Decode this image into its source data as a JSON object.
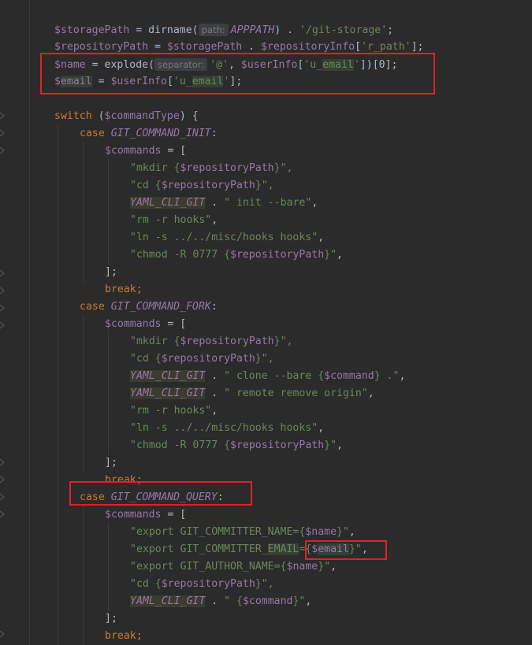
{
  "editor": {
    "lines": [
      {
        "indent": 69,
        "tokens": [
          {
            "t": "$storagePath",
            "c": "var"
          },
          {
            "t": " = ",
            "c": "plain"
          },
          {
            "t": "dirname(",
            "c": "plain"
          },
          {
            "t": "path:",
            "c": "hint"
          },
          {
            "t": "APPPATH",
            "c": "const"
          },
          {
            "t": ") . ",
            "c": "plain"
          },
          {
            "t": "'/git-storage'",
            "c": "str"
          },
          {
            "t": ";",
            "c": "plain"
          }
        ]
      },
      {
        "indent": 69,
        "tokens": [
          {
            "t": "$repositoryPath",
            "c": "var"
          },
          {
            "t": " = ",
            "c": "plain"
          },
          {
            "t": "$storagePath",
            "c": "var"
          },
          {
            "t": " . ",
            "c": "plain"
          },
          {
            "t": "$repositoryInfo",
            "c": "var"
          },
          {
            "t": "[",
            "c": "plain"
          },
          {
            "t": "'r_path'",
            "c": "str"
          },
          {
            "t": "];",
            "c": "plain"
          }
        ]
      },
      {
        "indent": 69,
        "tokens": [
          {
            "t": "$name",
            "c": "var"
          },
          {
            "t": " = ",
            "c": "plain"
          },
          {
            "t": "explode(",
            "c": "plain"
          },
          {
            "t": "separator:",
            "c": "hint"
          },
          {
            "t": "'@'",
            "c": "str"
          },
          {
            "t": ", ",
            "c": "plain"
          },
          {
            "t": "$userInfo",
            "c": "var"
          },
          {
            "t": "[",
            "c": "plain"
          },
          {
            "t": "'u_",
            "c": "str"
          },
          {
            "t": "email",
            "c": "str hl"
          },
          {
            "t": "'",
            "c": "str"
          },
          {
            "t": "])[0];",
            "c": "plain"
          }
        ]
      },
      {
        "indent": 69,
        "tokens": [
          {
            "t": "$",
            "c": "var"
          },
          {
            "t": "email",
            "c": "var hl"
          },
          {
            "t": " = ",
            "c": "plain"
          },
          {
            "t": "$userInfo",
            "c": "var"
          },
          {
            "t": "[",
            "c": "plain"
          },
          {
            "t": "'u_",
            "c": "str"
          },
          {
            "t": "email",
            "c": "str hl"
          },
          {
            "t": "'",
            "c": "str"
          },
          {
            "t": "];",
            "c": "plain"
          }
        ]
      },
      {
        "indent": 69,
        "tokens": []
      },
      {
        "indent": 69,
        "tokens": [
          {
            "t": "switch",
            "c": "kw"
          },
          {
            "t": " (",
            "c": "plain"
          },
          {
            "t": "$commandType",
            "c": "var"
          },
          {
            "t": ") {",
            "c": "plain"
          }
        ]
      },
      {
        "indent": 101,
        "tokens": [
          {
            "t": "case ",
            "c": "kw"
          },
          {
            "t": "GIT_COMMAND_INIT",
            "c": "const"
          },
          {
            "t": ":",
            "c": "plain"
          }
        ]
      },
      {
        "indent": 133,
        "tokens": [
          {
            "t": "$commands",
            "c": "var"
          },
          {
            "t": " = [",
            "c": "plain"
          }
        ]
      },
      {
        "indent": 165,
        "tokens": [
          {
            "t": "\"mkdir {",
            "c": "str"
          },
          {
            "t": "$repositoryPath",
            "c": "var"
          },
          {
            "t": "}\",",
            "c": "str"
          }
        ]
      },
      {
        "indent": 165,
        "tokens": [
          {
            "t": "\"cd {",
            "c": "str"
          },
          {
            "t": "$repositoryPath",
            "c": "var"
          },
          {
            "t": "}\",",
            "c": "str"
          }
        ]
      },
      {
        "indent": 165,
        "tokens": [
          {
            "t": "YAML_CLI_GIT",
            "c": "const hlc"
          },
          {
            "t": " . ",
            "c": "plain"
          },
          {
            "t": "\" init --bare\"",
            "c": "str"
          },
          {
            "t": ",",
            "c": "plain"
          }
        ]
      },
      {
        "indent": 165,
        "tokens": [
          {
            "t": "\"rm -r hooks\"",
            "c": "str"
          },
          {
            "t": ",",
            "c": "plain"
          }
        ]
      },
      {
        "indent": 165,
        "tokens": [
          {
            "t": "\"ln -s ../../misc/hooks hooks\"",
            "c": "str"
          },
          {
            "t": ",",
            "c": "plain"
          }
        ]
      },
      {
        "indent": 165,
        "tokens": [
          {
            "t": "\"chmod -R 0777 {",
            "c": "str"
          },
          {
            "t": "$repositoryPath",
            "c": "var"
          },
          {
            "t": "}\"",
            "c": "str"
          },
          {
            "t": ",",
            "c": "plain"
          }
        ]
      },
      {
        "indent": 133,
        "tokens": [
          {
            "t": "];",
            "c": "plain"
          }
        ]
      },
      {
        "indent": 133,
        "tokens": [
          {
            "t": "break;",
            "c": "kw"
          }
        ]
      },
      {
        "indent": 101,
        "tokens": [
          {
            "t": "case ",
            "c": "kw"
          },
          {
            "t": "GIT_COMMAND_FORK",
            "c": "const"
          },
          {
            "t": ":",
            "c": "plain"
          }
        ]
      },
      {
        "indent": 133,
        "tokens": [
          {
            "t": "$commands",
            "c": "var"
          },
          {
            "t": " = [",
            "c": "plain"
          }
        ]
      },
      {
        "indent": 165,
        "tokens": [
          {
            "t": "\"mkdir {",
            "c": "str"
          },
          {
            "t": "$repositoryPath",
            "c": "var"
          },
          {
            "t": "}\",",
            "c": "str"
          }
        ]
      },
      {
        "indent": 165,
        "tokens": [
          {
            "t": "\"cd {",
            "c": "str"
          },
          {
            "t": "$repositoryPath",
            "c": "var"
          },
          {
            "t": "}\",",
            "c": "str"
          }
        ]
      },
      {
        "indent": 165,
        "tokens": [
          {
            "t": "YAML_CLI_GIT",
            "c": "const hlc"
          },
          {
            "t": " . ",
            "c": "plain"
          },
          {
            "t": "\" clone --bare {",
            "c": "str"
          },
          {
            "t": "$command",
            "c": "var"
          },
          {
            "t": "} .\"",
            "c": "str"
          },
          {
            "t": ",",
            "c": "plain"
          }
        ]
      },
      {
        "indent": 165,
        "tokens": [
          {
            "t": "YAML_CLI_GIT",
            "c": "const hlc"
          },
          {
            "t": " . ",
            "c": "plain"
          },
          {
            "t": "\" remote remove origin\"",
            "c": "str"
          },
          {
            "t": ",",
            "c": "plain"
          }
        ]
      },
      {
        "indent": 165,
        "tokens": [
          {
            "t": "\"rm -r hooks\"",
            "c": "str"
          },
          {
            "t": ",",
            "c": "plain"
          }
        ]
      },
      {
        "indent": 165,
        "tokens": [
          {
            "t": "\"ln -s ../../misc/hooks hooks\"",
            "c": "str"
          },
          {
            "t": ",",
            "c": "plain"
          }
        ]
      },
      {
        "indent": 165,
        "tokens": [
          {
            "t": "\"chmod -R 0777 {",
            "c": "str"
          },
          {
            "t": "$repositoryPath",
            "c": "var"
          },
          {
            "t": "}\"",
            "c": "str"
          },
          {
            "t": ",",
            "c": "plain"
          }
        ]
      },
      {
        "indent": 133,
        "tokens": [
          {
            "t": "];",
            "c": "plain"
          }
        ]
      },
      {
        "indent": 133,
        "tokens": [
          {
            "t": "break;",
            "c": "kw"
          }
        ]
      },
      {
        "indent": 101,
        "tokens": [
          {
            "t": "case ",
            "c": "kw"
          },
          {
            "t": "GIT_COMMAND_QUERY",
            "c": "const"
          },
          {
            "t": ":",
            "c": "plain"
          }
        ]
      },
      {
        "indent": 133,
        "tokens": [
          {
            "t": "$commands",
            "c": "var"
          },
          {
            "t": " = [",
            "c": "plain"
          }
        ]
      },
      {
        "indent": 165,
        "tokens": [
          {
            "t": "\"export GIT_COMMITTER_NAME={",
            "c": "str"
          },
          {
            "t": "$name",
            "c": "var"
          },
          {
            "t": "}\"",
            "c": "str"
          },
          {
            "t": ",",
            "c": "plain"
          }
        ]
      },
      {
        "indent": 165,
        "tokens": [
          {
            "t": "\"export GIT_COMMITTER_",
            "c": "str"
          },
          {
            "t": "EMAIL",
            "c": "str hl"
          },
          {
            "t": "={",
            "c": "str"
          },
          {
            "t": "$",
            "c": "var"
          },
          {
            "t": "email",
            "c": "var hl"
          },
          {
            "t": "}\"",
            "c": "str"
          },
          {
            "t": ",",
            "c": "plain"
          }
        ]
      },
      {
        "indent": 165,
        "tokens": [
          {
            "t": "\"export GIT_AUTHOR_NAME={",
            "c": "str"
          },
          {
            "t": "$name",
            "c": "var"
          },
          {
            "t": "}\"",
            "c": "str"
          },
          {
            "t": ",",
            "c": "plain"
          }
        ]
      },
      {
        "indent": 165,
        "tokens": [
          {
            "t": "\"cd {",
            "c": "str"
          },
          {
            "t": "$repositoryPath",
            "c": "var"
          },
          {
            "t": "}\",",
            "c": "str"
          }
        ]
      },
      {
        "indent": 165,
        "tokens": [
          {
            "t": "YAML_CLI_GIT",
            "c": "const hlc"
          },
          {
            "t": " . ",
            "c": "plain"
          },
          {
            "t": "\" {",
            "c": "str"
          },
          {
            "t": "$command",
            "c": "var"
          },
          {
            "t": "}\"",
            "c": "str"
          },
          {
            "t": ",",
            "c": "plain"
          }
        ]
      },
      {
        "indent": 133,
        "tokens": [
          {
            "t": "];",
            "c": "plain"
          }
        ]
      },
      {
        "indent": 133,
        "tokens": [
          {
            "t": "break;",
            "c": "kw"
          }
        ]
      }
    ]
  },
  "colors": {
    "background": "#2b2b2b",
    "annotation": "#e0202a"
  }
}
